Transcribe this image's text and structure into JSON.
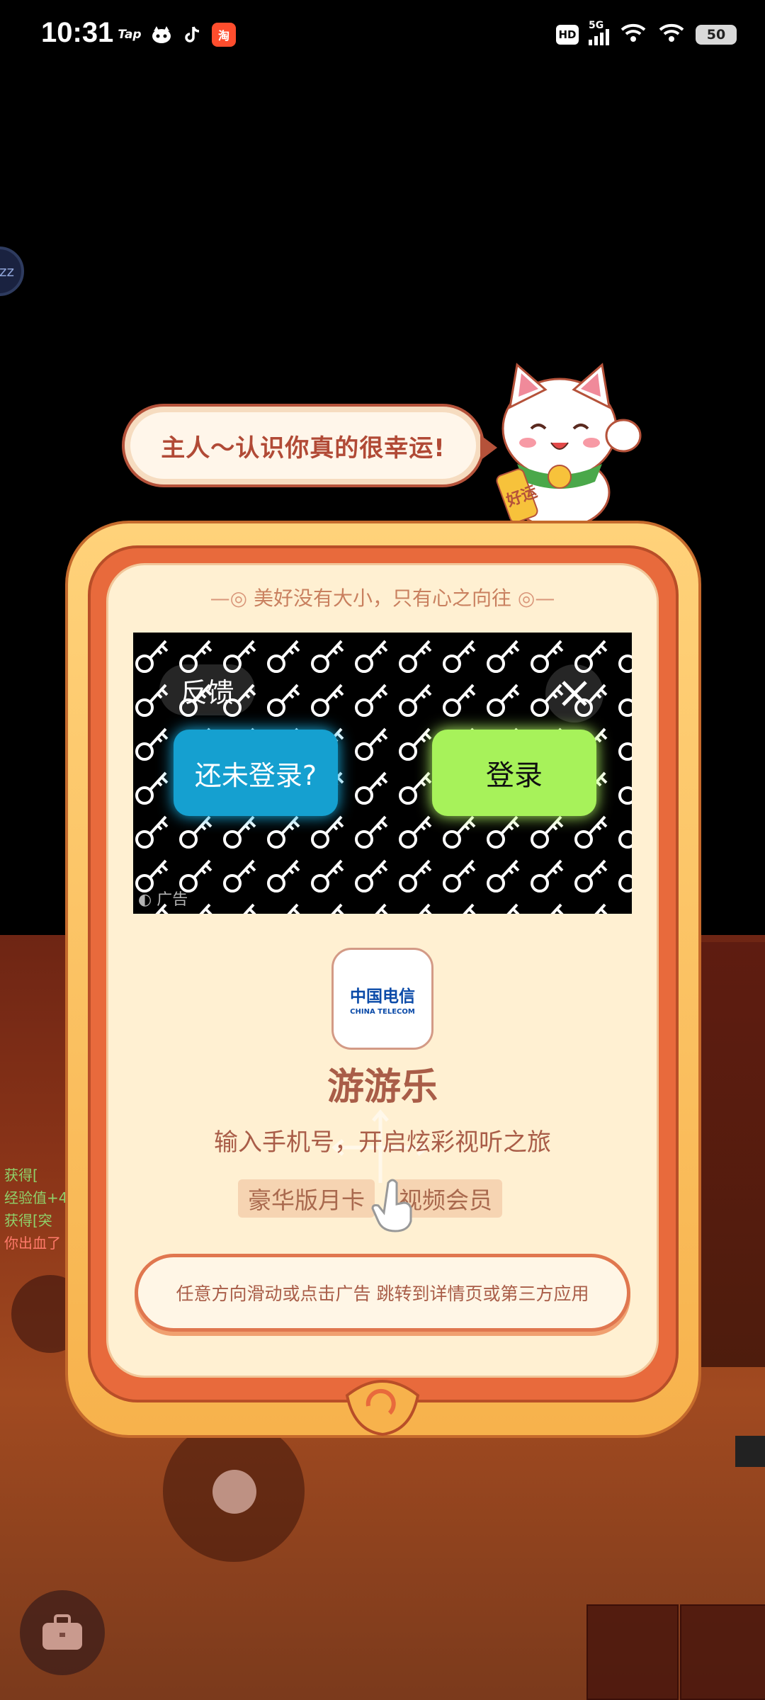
{
  "status_bar": {
    "time": "10:31",
    "apps": [
      "Tap",
      "淘"
    ],
    "hd": "HD",
    "network": "5G",
    "battery": "50"
  },
  "game": {
    "chat_lines": [
      "获得[",
      "经验值+4",
      "获得[突",
      "你出血了"
    ],
    "side_button": "zz"
  },
  "bubble": {
    "text": "主人～认识你真的很幸运!"
  },
  "cat": {
    "badge": "好运"
  },
  "ad": {
    "slogan": "美好没有大小，只有心之向往",
    "feedback_label": "反馈",
    "not_logged_in_label": "还未登录?",
    "login_label": "登录",
    "ad_tag": "广告",
    "logo_cn": "中国电信",
    "logo_en": "CHINA TELECOM",
    "app_name": "游游乐",
    "description": "输入手机号，开启炫彩视听之旅",
    "tags": [
      "豪华版月卡",
      "视频会员"
    ],
    "cta": "任意方向滑动或点击广告 跳转到详情页或第三方应用"
  },
  "colors": {
    "frame_orange": "#e86a3c",
    "frame_gold": "#f7b24c",
    "text_brown": "#a95d48",
    "blue_button": "#15a0d0",
    "green_button": "#a7f25a"
  }
}
